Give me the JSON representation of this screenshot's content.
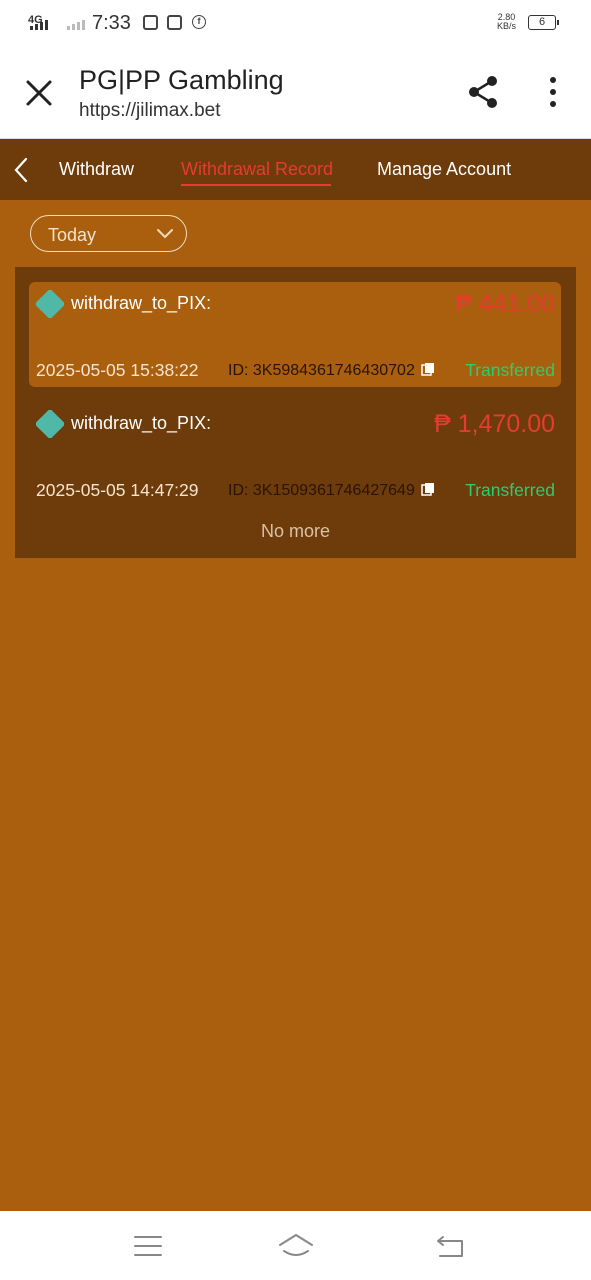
{
  "status_bar": {
    "network": "4G",
    "time": "7:33",
    "speed_value": "2.80",
    "speed_unit": "KB/s",
    "battery": "6"
  },
  "browser": {
    "title": "PG|PP Gambling",
    "url": "https://jilimax.bet",
    "icons": [
      "close-icon",
      "share-icon",
      "more-vert-icon"
    ]
  },
  "tabs": [
    {
      "label": "Withdraw",
      "active": false
    },
    {
      "label": "Withdrawal Record",
      "active": true
    },
    {
      "label": "Manage Account",
      "active": false
    }
  ],
  "filter": {
    "selected": "Today"
  },
  "records": [
    {
      "method": "withdraw_to_PIX:",
      "amount": "₱ 441.00",
      "datetime": "2025-05-05 15:38:22",
      "id": "ID: 3K5984361746430702",
      "status": "Transferred"
    },
    {
      "method": "withdraw_to_PIX:",
      "amount": "₱ 1,470.00",
      "datetime": "2025-05-05 14:47:29",
      "id": "ID: 3K1509361746427649",
      "status": "Transferred"
    }
  ],
  "footer_text": "No more",
  "colors": {
    "page_bg": "#a95f0e",
    "panel_bg": "#6e3b0b",
    "accent_red": "#e63b2e",
    "status_green": "#2ecc71",
    "pix_teal": "#4fb8a7"
  },
  "nav_icons": [
    "menu-icon",
    "home-icon",
    "back-icon"
  ]
}
